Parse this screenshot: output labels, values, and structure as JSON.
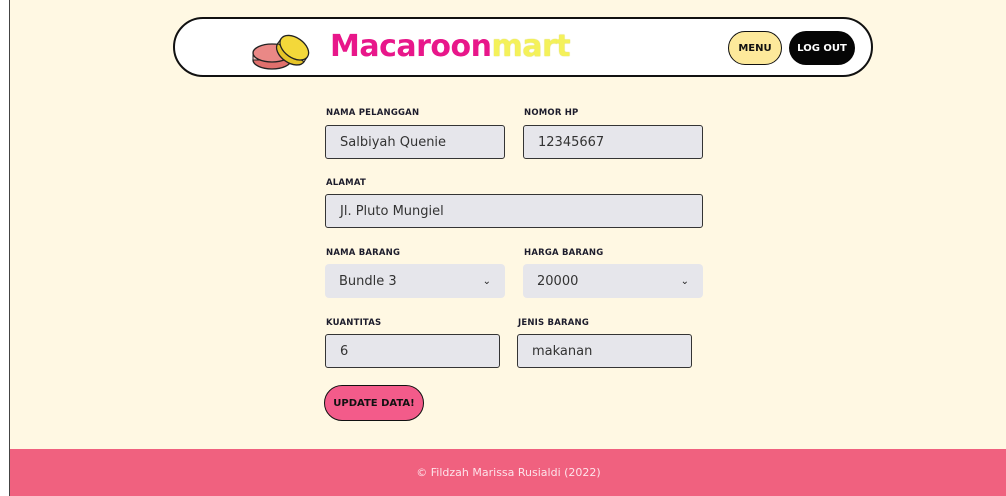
{
  "header": {
    "brand_part1": "Macaroon",
    "brand_part2": "mart",
    "menu_label": "MENU",
    "logout_label": "LOG OUT"
  },
  "form": {
    "nama_pelanggan": {
      "label": "NAMA PELANGGAN",
      "value": "Salbiyah Quenie"
    },
    "nomor_hp": {
      "label": "NOMOR HP",
      "value": "12345667"
    },
    "alamat": {
      "label": "ALAMAT",
      "value": "Jl. Pluto Mungiel"
    },
    "nama_barang": {
      "label": "NAMA BARANG",
      "selected": "Bundle 3"
    },
    "harga_barang": {
      "label": "HARGA BARANG",
      "selected": "20000"
    },
    "kuantitas": {
      "label": "KUANTITAS",
      "value": "6"
    },
    "jenis_barang": {
      "label": "JENIS BARANG",
      "value": "makanan"
    },
    "submit_label": "UPDATE DATA!"
  },
  "footer": {
    "text": "© Fildzah Marissa Rusialdi (2022)"
  },
  "colors": {
    "background": "#fff8e3",
    "brand_pink": "#e8178a",
    "brand_yellow": "#f4f15a",
    "menu_button": "#fde99b",
    "update_button": "#f35b8a",
    "footer": "#f0617f"
  }
}
